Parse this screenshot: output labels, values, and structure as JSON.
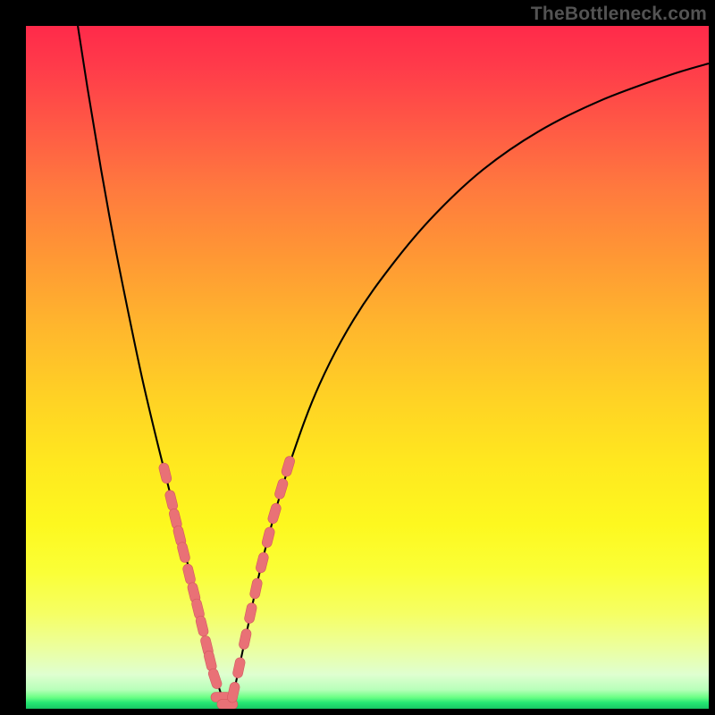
{
  "watermark": "TheBottleneck.com",
  "colors": {
    "frame": "#000000",
    "curve": "#000000",
    "marker_fill": "#e97176",
    "marker_stroke": "#d3595f"
  },
  "chart_data": {
    "type": "line",
    "title": "",
    "xlabel": "",
    "ylabel": "",
    "xlim": [
      0,
      100
    ],
    "ylim": [
      0,
      100
    ],
    "note": "V-shaped bottleneck curve. x is horizontal position (% of plot width), y is vertical position from top (% of plot height). Higher y = lower on screen = closer to green optimal zone.",
    "series": [
      {
        "name": "curve",
        "x": [
          7.6,
          9,
          11,
          13,
          15,
          17,
          19,
          20.5,
          22,
          23.5,
          24.7,
          25.7,
          27.4,
          29.2,
          30,
          31,
          32.5,
          34,
          36,
          39,
          43,
          48,
          54,
          60,
          67,
          75,
          84,
          94,
          100
        ],
        "y": [
          0,
          9,
          21,
          32,
          42,
          51.5,
          60,
          66,
          72,
          78,
          83,
          87,
          94,
          99.4,
          99.4,
          95,
          88,
          81,
          73,
          63,
          52.5,
          43,
          34.5,
          27.5,
          21,
          15.5,
          11,
          7.3,
          5.5
        ]
      }
    ],
    "markers": {
      "name": "highlighted-points",
      "note": "Salmon capsule markers clustered near the bottom of the V on both branches.",
      "points": [
        {
          "x": 20.4,
          "y": 65.5
        },
        {
          "x": 21.3,
          "y": 69.5
        },
        {
          "x": 21.9,
          "y": 72.2
        },
        {
          "x": 22.5,
          "y": 74.7
        },
        {
          "x": 23.1,
          "y": 77.1
        },
        {
          "x": 23.9,
          "y": 80.3
        },
        {
          "x": 24.6,
          "y": 83.0
        },
        {
          "x": 25.2,
          "y": 85.4
        },
        {
          "x": 25.8,
          "y": 87.9
        },
        {
          "x": 26.5,
          "y": 90.8
        },
        {
          "x": 27.0,
          "y": 93.0
        },
        {
          "x": 27.7,
          "y": 95.6
        },
        {
          "x": 28.6,
          "y": 98.3
        },
        {
          "x": 29.5,
          "y": 99.35
        },
        {
          "x": 30.4,
          "y": 97.6
        },
        {
          "x": 31.2,
          "y": 94.0
        },
        {
          "x": 32.1,
          "y": 89.8
        },
        {
          "x": 32.9,
          "y": 86.0
        },
        {
          "x": 33.7,
          "y": 82.4
        },
        {
          "x": 34.6,
          "y": 78.6
        },
        {
          "x": 35.5,
          "y": 74.9
        },
        {
          "x": 36.4,
          "y": 71.4
        },
        {
          "x": 37.4,
          "y": 67.8
        },
        {
          "x": 38.4,
          "y": 64.5
        }
      ]
    }
  }
}
